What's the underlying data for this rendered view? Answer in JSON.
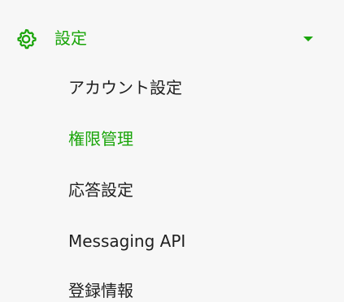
{
  "colors": {
    "background": "#f7f7f7",
    "accent": "#1aa50a",
    "text": "#1f1f1f"
  },
  "sidebar": {
    "section": {
      "icon": "gear-icon",
      "label": "設定",
      "expand_icon": "caret-down-icon"
    },
    "items": [
      {
        "label": "アカウント設定",
        "active": false
      },
      {
        "label": "権限管理",
        "active": true
      },
      {
        "label": "応答設定",
        "active": false
      },
      {
        "label": "Messaging API",
        "active": false
      },
      {
        "label": "登録情報",
        "active": false
      }
    ]
  }
}
